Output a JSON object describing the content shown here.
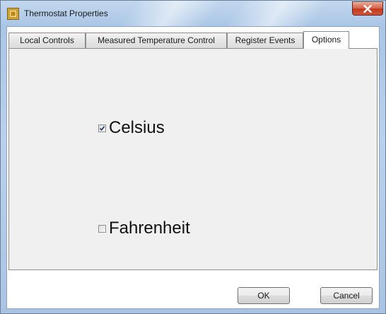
{
  "window": {
    "title": "Thermostat Properties",
    "icon": "thermostat-app-icon",
    "close_icon": "close-icon"
  },
  "tabs": [
    {
      "label": "Local Controls",
      "active": false
    },
    {
      "label": "Measured Temperature Control",
      "active": false
    },
    {
      "label": "Register Events",
      "active": false
    },
    {
      "label": "Options",
      "active": true
    }
  ],
  "options": {
    "celsius": {
      "label": "Celsius",
      "checked": true
    },
    "fahrenheit": {
      "label": "Fahrenheit",
      "checked": false
    }
  },
  "buttons": {
    "ok": "OK",
    "cancel": "Cancel"
  },
  "colors": {
    "close_button": "#c2391c",
    "frame": "#b9d1ec"
  }
}
